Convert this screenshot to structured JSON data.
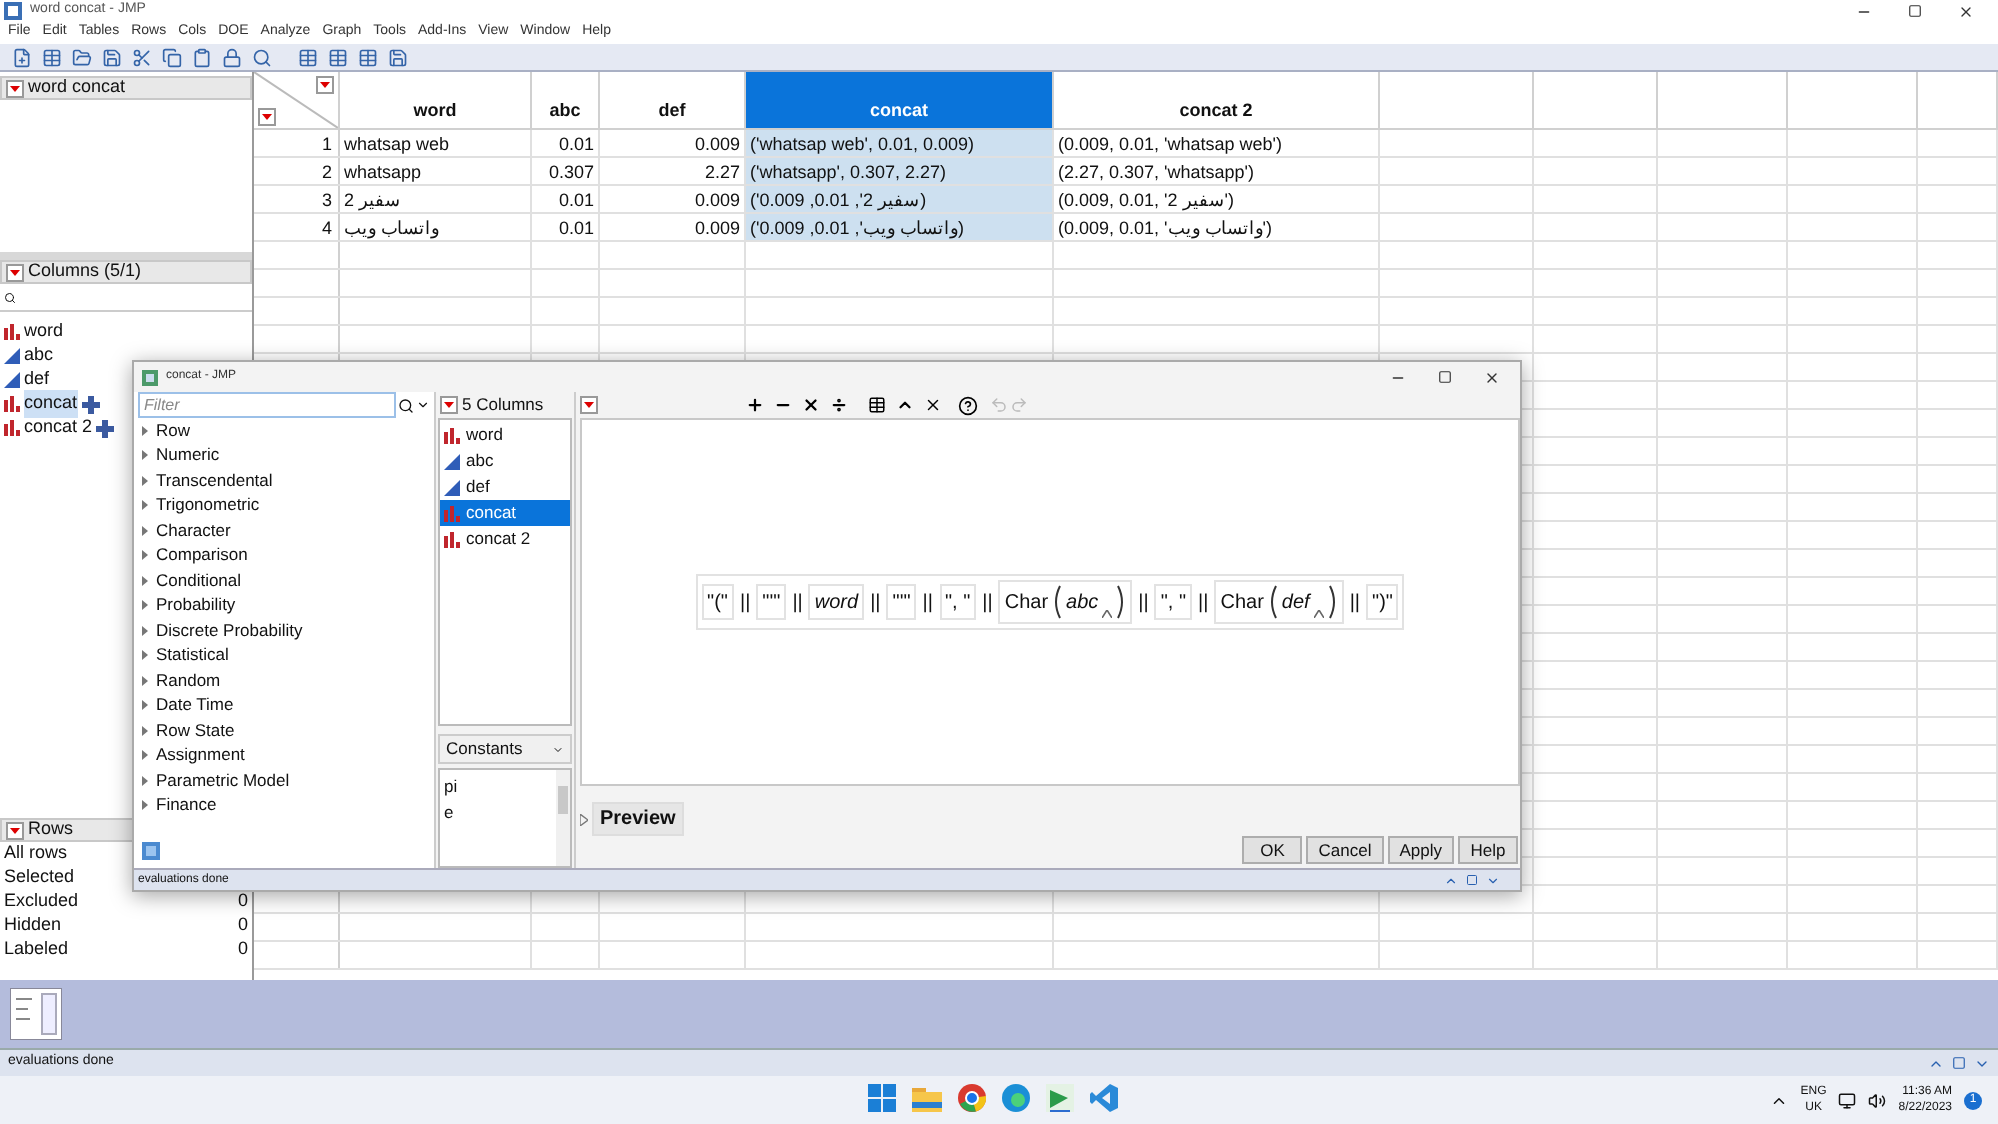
{
  "window": {
    "title": "word concat - JMP"
  },
  "menu": [
    "File",
    "Edit",
    "Tables",
    "Rows",
    "Cols",
    "DOE",
    "Analyze",
    "Graph",
    "Tools",
    "Add-Ins",
    "View",
    "Window",
    "Help"
  ],
  "table_panel": {
    "title": "word concat"
  },
  "columns_panel": {
    "title": "Columns (5/1)",
    "items": [
      {
        "name": "word",
        "kind": "nominal",
        "selected": false,
        "formula": false
      },
      {
        "name": "abc",
        "kind": "continuous",
        "selected": false,
        "formula": false
      },
      {
        "name": "def",
        "kind": "continuous",
        "selected": false,
        "formula": false
      },
      {
        "name": "concat",
        "kind": "nominal",
        "selected": true,
        "formula": true
      },
      {
        "name": "concat 2",
        "kind": "nominal",
        "selected": false,
        "formula": true
      }
    ]
  },
  "rows_panel": {
    "title": "Rows",
    "items": [
      {
        "label": "All rows"
      },
      {
        "label": "Selected"
      },
      {
        "label": "Excluded",
        "value": "0"
      },
      {
        "label": "Hidden",
        "value": "0"
      },
      {
        "label": "Labeled",
        "value": "0"
      }
    ]
  },
  "table": {
    "columns": [
      {
        "label": "word",
        "selected": false,
        "kind": "character"
      },
      {
        "label": "abc",
        "selected": false,
        "kind": "numeric"
      },
      {
        "label": "def",
        "selected": false,
        "kind": "numeric"
      },
      {
        "label": "concat",
        "selected": true,
        "kind": "character"
      },
      {
        "label": "concat 2",
        "selected": false,
        "kind": "character"
      }
    ],
    "rows": [
      {
        "number": "1",
        "cells": [
          "whatsap web",
          "0.01",
          "0.009",
          "('whatsap web', 0.01, 0.009)",
          "(0.009, 0.01, 'whatsap web')"
        ]
      },
      {
        "number": "2",
        "cells": [
          "whatsapp",
          "0.307",
          "2.27",
          "('whatsapp', 0.307, 2.27)",
          "(2.27, 0.307, 'whatsapp')"
        ]
      },
      {
        "number": "3",
        "cells": [
          "سفير 2",
          "0.01",
          "0.009",
          "('سفير 2', 0.01, 0.009)",
          "(0.009, 0.01, 'سفير 2')"
        ]
      },
      {
        "number": "4",
        "cells": [
          "واتساب ويب",
          "0.01",
          "0.009",
          "('واتساب ويب', 0.01, 0.009)",
          "(0.009, 0.01, 'واتساب ويب')"
        ]
      }
    ]
  },
  "dialog": {
    "title": "concat - JMP",
    "filter_placeholder": "Filter",
    "categories": [
      "Row",
      "Numeric",
      "Transcendental",
      "Trigonometric",
      "Character",
      "Comparison",
      "Conditional",
      "Probability",
      "Discrete Probability",
      "Statistical",
      "Random",
      "Date Time",
      "Row State",
      "Assignment",
      "Parametric Model",
      "Finance"
    ],
    "columns_header": "5 Columns",
    "columns": [
      {
        "name": "word",
        "kind": "nominal",
        "selected": false
      },
      {
        "name": "abc",
        "kind": "continuous",
        "selected": false
      },
      {
        "name": "def",
        "kind": "continuous",
        "selected": false
      },
      {
        "name": "concat",
        "kind": "nominal",
        "selected": true
      },
      {
        "name": "concat 2",
        "kind": "nominal",
        "selected": false
      }
    ],
    "constants_label": "Constants",
    "constants": [
      "pi",
      "e"
    ],
    "formula": [
      {
        "kind": "string",
        "text": "\"(\""
      },
      {
        "kind": "operator",
        "text": "||"
      },
      {
        "kind": "string",
        "text": "\"'\""
      },
      {
        "kind": "operator",
        "text": "||"
      },
      {
        "kind": "column",
        "text": "word"
      },
      {
        "kind": "operator",
        "text": "||"
      },
      {
        "kind": "string",
        "text": "\"'\""
      },
      {
        "kind": "operator",
        "text": "||"
      },
      {
        "kind": "string",
        "text": "\", \""
      },
      {
        "kind": "operator",
        "text": "||"
      },
      {
        "kind": "function",
        "text": "Char",
        "arg": "abc"
      },
      {
        "kind": "operator",
        "text": "||"
      },
      {
        "kind": "string",
        "text": "\", \""
      },
      {
        "kind": "operator",
        "text": "||"
      },
      {
        "kind": "function",
        "text": "Char",
        "arg": "def"
      },
      {
        "kind": "operator",
        "text": "||"
      },
      {
        "kind": "string",
        "text": "\")\""
      }
    ],
    "preview": "Preview",
    "buttons": [
      "OK",
      "Cancel",
      "Apply",
      "Help"
    ],
    "status": "evaluations done"
  },
  "status_bar": "evaluations done",
  "taskbar": {
    "language": "ENG",
    "region": "UK",
    "time": "11:36 AM",
    "date": "8/22/2023",
    "notifications": "1"
  }
}
